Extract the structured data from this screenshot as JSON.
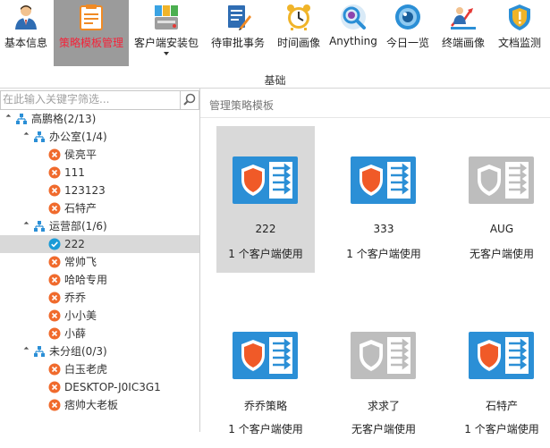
{
  "ribbon": {
    "buttons": [
      {
        "label": "基本信息",
        "icon": "user-info-icon"
      },
      {
        "label": "策略模板管理",
        "icon": "policy-template-icon"
      },
      {
        "label": "客户端安装包",
        "icon": "client-package-icon"
      },
      {
        "label": "待审批事务",
        "icon": "approval-icon"
      },
      {
        "label": "时间画像",
        "icon": "alarm-clock-icon"
      },
      {
        "label": "Anything",
        "icon": "anything-search-icon"
      },
      {
        "label": "今日一览",
        "icon": "eye-icon"
      },
      {
        "label": "终端画像",
        "icon": "terminal-profile-icon"
      },
      {
        "label": "文档监测",
        "icon": "document-shield-icon"
      }
    ],
    "group_label": "基础",
    "active_color": "#f4233a"
  },
  "search": {
    "placeholder": "在此输入关键字筛选..."
  },
  "tree": [
    {
      "label": "高鹏格(2/13)",
      "type": "root"
    },
    {
      "label": "办公室(1/4)",
      "type": "group"
    },
    {
      "label": "侯亮平",
      "type": "offline"
    },
    {
      "label": "111",
      "type": "offline"
    },
    {
      "label": "123123",
      "type": "offline"
    },
    {
      "label": "石特产",
      "type": "offline"
    },
    {
      "label": "运营部(1/6)",
      "type": "group"
    },
    {
      "label": "222",
      "type": "online",
      "selected": true
    },
    {
      "label": "常帅飞",
      "type": "offline"
    },
    {
      "label": "哈哈专用",
      "type": "offline"
    },
    {
      "label": "乔乔",
      "type": "offline"
    },
    {
      "label": "小小美",
      "type": "offline"
    },
    {
      "label": "小薛",
      "type": "offline"
    },
    {
      "label": "未分组(0/3)",
      "type": "group"
    },
    {
      "label": "白玉老虎",
      "type": "offline"
    },
    {
      "label": "DESKTOP-J0IC3G1",
      "type": "offline"
    },
    {
      "label": "痞帅大老板",
      "type": "offline"
    }
  ],
  "main": {
    "title": "管理策略模板",
    "templates": [
      {
        "name": "222",
        "status": "1 个客户端使用",
        "active": true,
        "selected": true
      },
      {
        "name": "333",
        "status": "1 个客户端使用",
        "active": true
      },
      {
        "name": "AUG",
        "status": "无客户端使用",
        "active": false
      },
      {
        "name": "乔乔策略",
        "status": "1 个客户端使用",
        "active": true
      },
      {
        "name": "求求了",
        "status": "无客户端使用",
        "active": false
      },
      {
        "name": "石特产",
        "status": "1 个客户端使用",
        "active": true
      }
    ]
  },
  "colors": {
    "blue": "#2b8fd6",
    "orange": "#f05a28",
    "gray": "#bdbdbd",
    "offline_red": "#f06a2c",
    "online_teal": "#1a9bd7"
  }
}
